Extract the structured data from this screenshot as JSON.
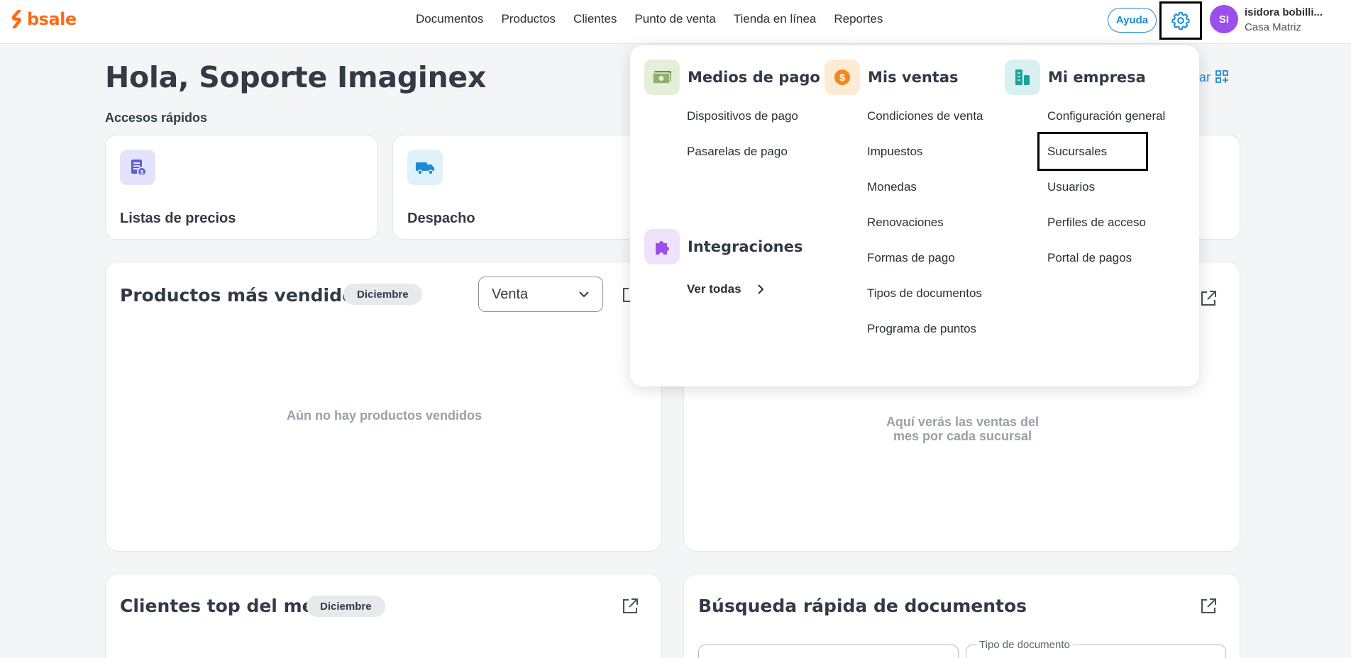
{
  "app": {
    "logo_text": "bsale",
    "brand_color": "#ff6a13",
    "accent": "#1b8bd1"
  },
  "nav": {
    "items": [
      "Documentos",
      "Productos",
      "Clientes",
      "Punto de venta",
      "Tienda en línea",
      "Reportes"
    ]
  },
  "header": {
    "help_label": "Ayuda",
    "settings_icon": "gear-icon",
    "avatar_initials": "SI",
    "user_name": "isidora bobilli...",
    "user_branch": "Casa Matriz"
  },
  "greeting": "Hola, Soporte Imaginex",
  "quick_access": {
    "label": "Accesos rápidos",
    "cards": [
      {
        "title": "Listas de precios",
        "icon": "price-list-icon"
      },
      {
        "title": "Despacho",
        "icon": "truck-icon"
      }
    ],
    "right_link_partial": "ar"
  },
  "panels": {
    "top_products": {
      "title": "Productos más vendidos",
      "chip": "Diciembre",
      "select_value": "Venta",
      "empty": "Aún no hay productos vendidos"
    },
    "sales_by_branch": {
      "empty_line1": "Aquí verás las ventas del",
      "empty_line2": "mes por cada sucursal"
    },
    "top_clients": {
      "title": "Clientes top del mes",
      "chip": "Diciembre"
    },
    "doc_search": {
      "title": "Búsqueda rápida de documentos",
      "doc_type_label": "Tipo de documento"
    }
  },
  "settings_menu": {
    "payment": {
      "title": "Medios de pago",
      "items": [
        "Dispositivos de pago",
        "Pasarelas de pago"
      ]
    },
    "integrations": {
      "title": "Integraciones",
      "link": "Ver todas"
    },
    "sales": {
      "title": "Mis ventas",
      "items": [
        "Condiciones de venta",
        "Impuestos",
        "Monedas",
        "Renovaciones",
        "Formas de pago",
        "Tipos de documentos",
        "Programa de puntos"
      ]
    },
    "company": {
      "title": "Mi empresa",
      "items": [
        "Configuración general",
        "Sucursales",
        "Usuarios",
        "Perfiles de acceso",
        "Portal de pagos"
      ],
      "highlighted": "Sucursales"
    }
  }
}
